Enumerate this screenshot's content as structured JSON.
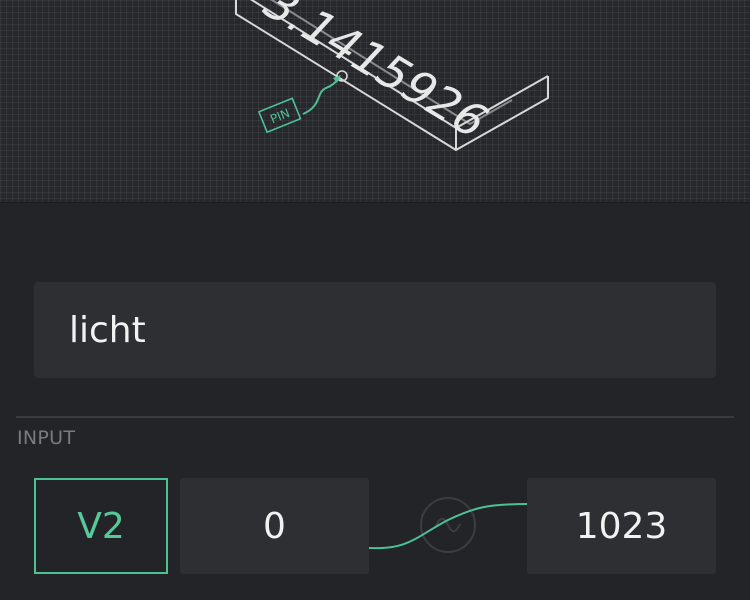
{
  "illustration": {
    "display_digits": "3.1415926",
    "pin_tag": "PIN"
  },
  "widget": {
    "name_value": "licht"
  },
  "input_section": {
    "label": "INPUT",
    "pin": "V2",
    "min": "0",
    "max": "1023"
  },
  "colors": {
    "accent": "#4cc194",
    "background": "#232427",
    "field": "#2e2f33"
  }
}
